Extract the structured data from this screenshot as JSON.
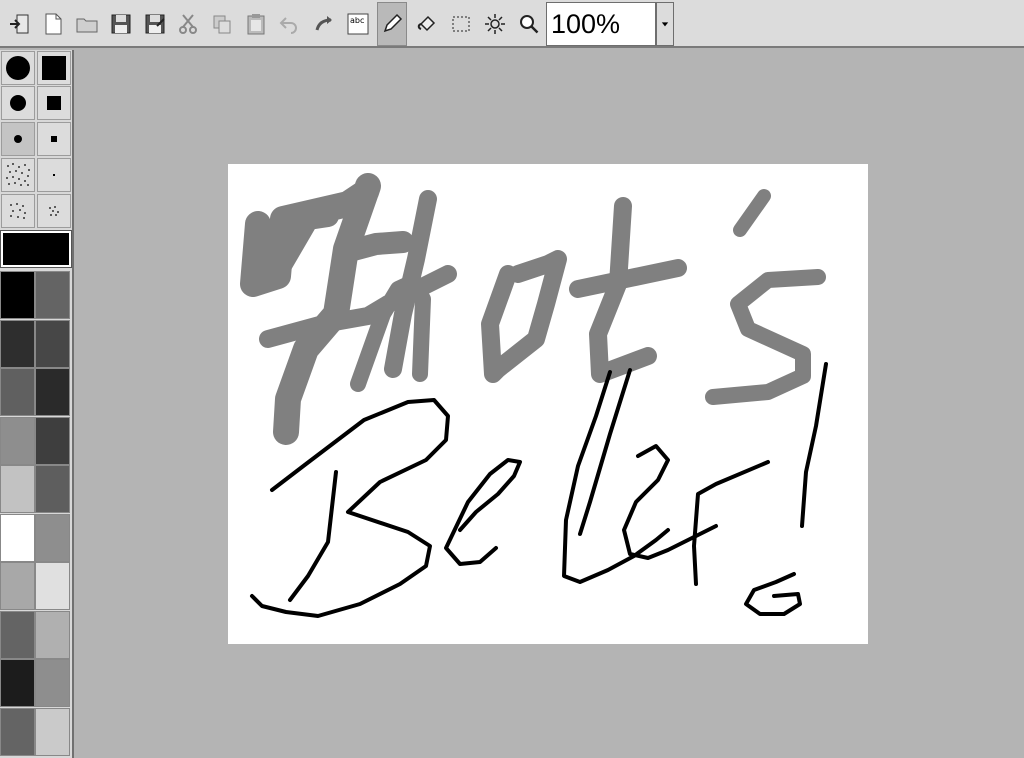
{
  "toolbar": {
    "buttons": [
      {
        "name": "exit-icon",
        "label": "exit"
      },
      {
        "name": "new-file-icon",
        "label": "new"
      },
      {
        "name": "open-folder-icon",
        "label": "open"
      },
      {
        "name": "save-icon",
        "label": "save"
      },
      {
        "name": "save-as-icon",
        "label": "save as"
      },
      {
        "name": "cut-icon",
        "label": "cut"
      },
      {
        "name": "copy-icon",
        "label": "copy"
      },
      {
        "name": "paste-icon",
        "label": "paste"
      },
      {
        "name": "undo-icon",
        "label": "undo"
      },
      {
        "name": "redo-icon",
        "label": "redo"
      },
      {
        "name": "text-tool-icon",
        "label": "text"
      },
      {
        "name": "pencil-icon",
        "label": "pencil"
      },
      {
        "name": "fill-bucket-icon",
        "label": "fill"
      },
      {
        "name": "select-rect-icon",
        "label": "select"
      },
      {
        "name": "effects-icon",
        "label": "effects"
      },
      {
        "name": "zoom-icon",
        "label": "zoom"
      }
    ],
    "text_icon_letters": "abc",
    "zoom_value": "100%"
  },
  "brushes": [
    "circle-large",
    "square-large",
    "circle-medium",
    "square-medium",
    "circle-small",
    "square-small",
    "spray-large",
    "dot-tiny",
    "spray-medium",
    "spray-small"
  ],
  "selected_brush": "circle-small",
  "current_color": "#000000",
  "palette": [
    "#000000",
    "#646464",
    "#2e2e2e",
    "#474747",
    "#606060",
    "#2a2a2a",
    "#8e8e8e",
    "#3e3e3e",
    "#c2c2c2",
    "#5e5e5e",
    "#ffffff",
    "#8e8e8e",
    "#a8a8a8",
    "#e0e0e0",
    "#646464",
    "#b0b0b0",
    "#1c1c1c",
    "#8e8e8e",
    "#646464",
    "#cacaca"
  ],
  "canvas": {
    "background": "#ffffff",
    "stroke_gray": "#808080",
    "stroke_black": "#000000"
  }
}
